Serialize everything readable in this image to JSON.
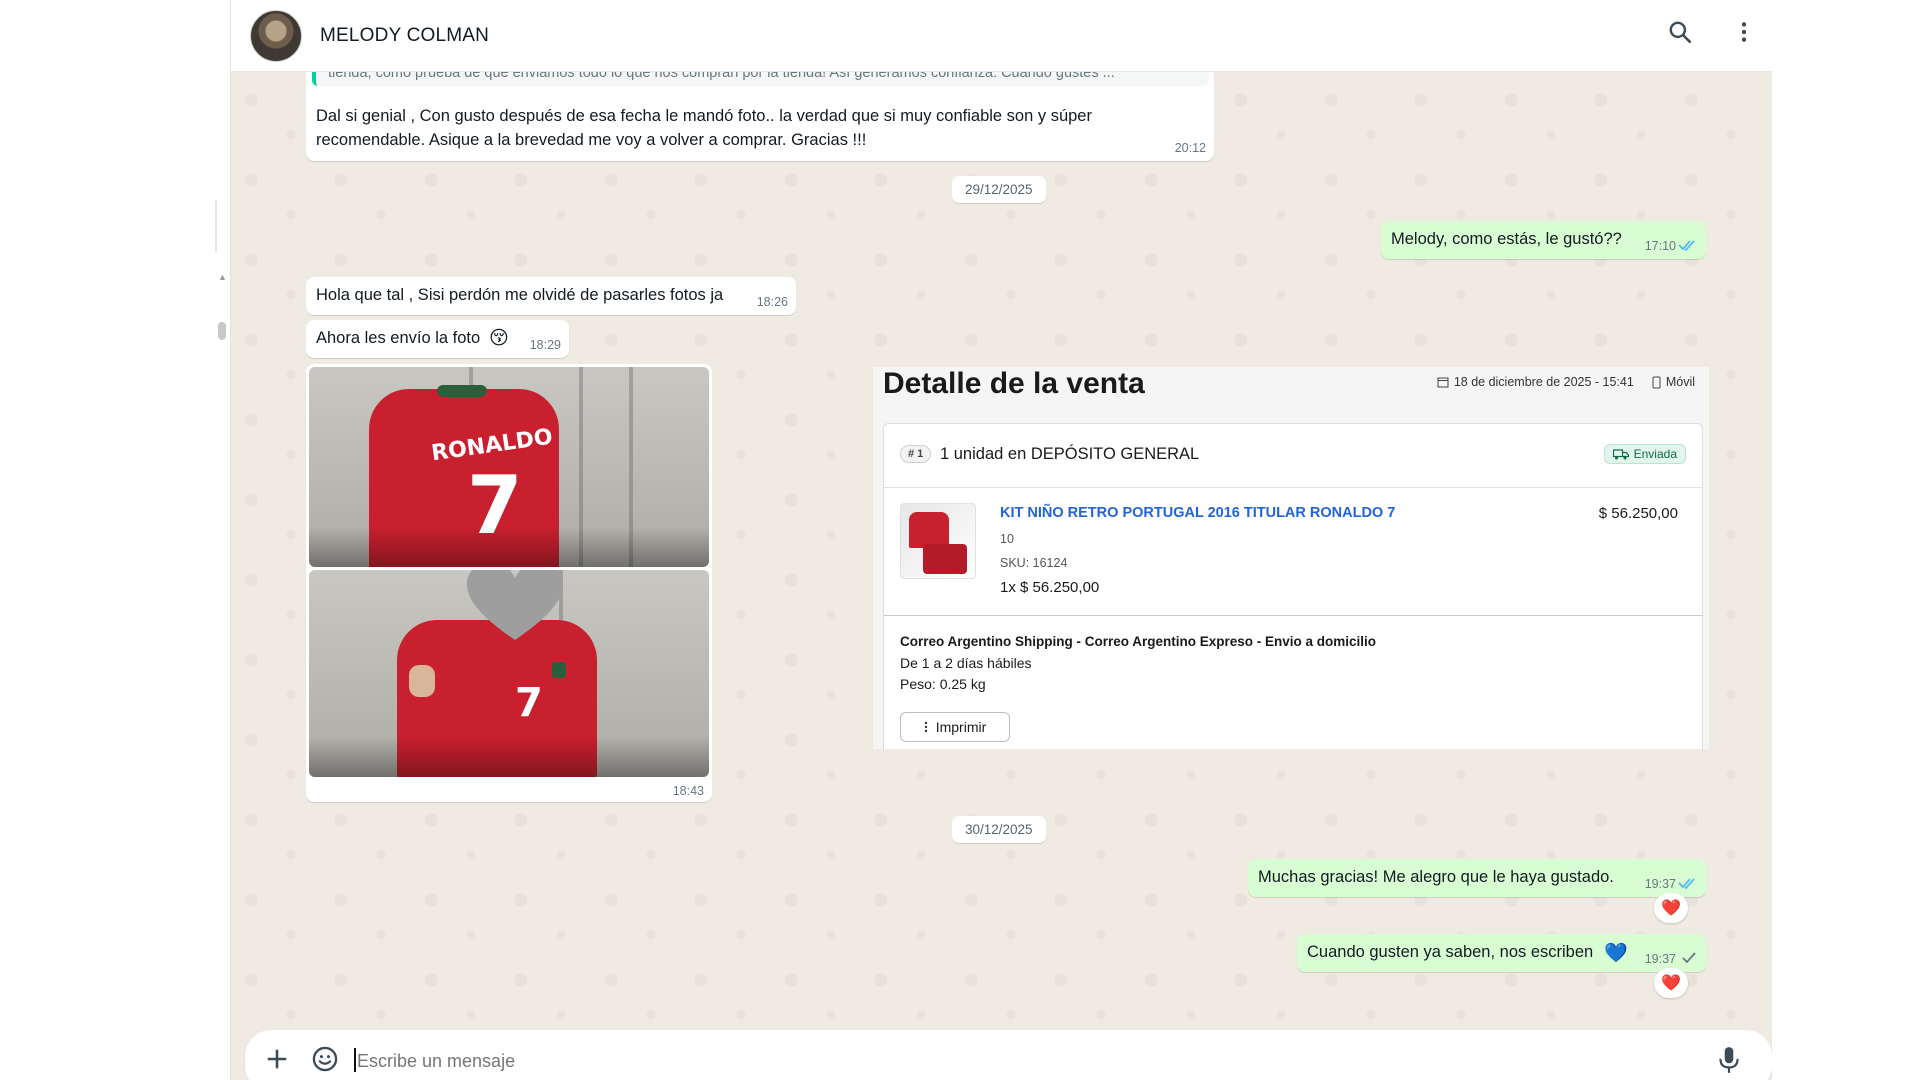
{
  "contact": {
    "name": "MELODY COLMAN"
  },
  "header": {
    "search_icon": "search-icon",
    "menu_icon": "kebab-menu-icon"
  },
  "messages": {
    "quoted_preview": "tienda, como prueba de que enviamos todo lo que nos compran por la tienda! Así generamos confianza. Cuando gustes ...",
    "m1": {
      "text_line1": "Dal si genial , Con gusto después de esa fecha le mandó foto.. la verdad que si muy confiable son y súper",
      "text_line2": "recomendable. Asique a la brevedad me voy a volver a comprar. Gracias !!!",
      "time": "20:12"
    },
    "date1": "29/12/2025",
    "m2": {
      "text": "Melody, como estás, le gustó??",
      "time": "17:10",
      "status": "read"
    },
    "m3": {
      "text": "Hola que tal , Sisi perdón me olvidé de pasarles fotos ja",
      "time": "18:26"
    },
    "m4": {
      "text": "Ahora les envío la foto",
      "emoji": "😚",
      "time": "18:29"
    },
    "photos": {
      "time": "18:43",
      "jersey_name": "RONALDO",
      "jersey_number": "7"
    },
    "date2": "30/12/2025",
    "m5": {
      "text": "Muchas gracias! Me alegro que le haya gustado.",
      "time": "19:37",
      "status": "read",
      "reaction": "❤️"
    },
    "m6": {
      "text": "Cuando gusten ya saben, nos escriben",
      "emoji": "💙",
      "time": "19:37",
      "status": "sent",
      "reaction": "❤️"
    }
  },
  "sale": {
    "title": "Detalle de la venta",
    "date": "18 de diciembre de 2025 - 15:41",
    "channel": "Móvil",
    "item_index": "# 1",
    "unit_text": "1 unidad en DEPÓSITO GENERAL",
    "status": "Enviada",
    "product_name": "KIT NIÑO RETRO PORTUGAL 2016 TITULAR RONALDO 7",
    "size": "10",
    "sku": "SKU: 16124",
    "qty_price": "1x $ 56.250,00",
    "price": "$ 56.250,00",
    "shipping_title": "Correo Argentino Shipping - Correo Argentino Expreso - Envio a domicilio",
    "shipping_days": "De 1 a 2 días hábiles",
    "shipping_weight": "Peso: 0.25 kg",
    "print_label": "Imprimir"
  },
  "composer": {
    "placeholder": "Escribe un mensaje"
  },
  "colors": {
    "outgoing": "#d9fdd3",
    "incoming": "#ffffff",
    "wallpaper": "#efeae2",
    "read_ticks": "#53bdeb",
    "link": "#2064d8"
  }
}
